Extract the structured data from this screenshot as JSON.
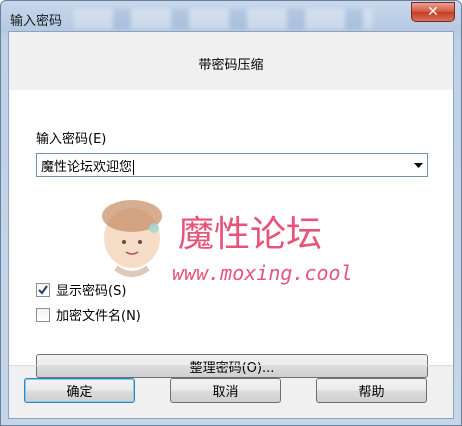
{
  "window": {
    "title": "输入密码",
    "close_glyph": "✕"
  },
  "header": {
    "title": "带密码压缩"
  },
  "password": {
    "label": "输入密码(E)",
    "value": "魔性论坛欢迎您"
  },
  "options": {
    "show_password_label": "显示密码(S)",
    "show_password_checked": true,
    "encrypt_filenames_label": "加密文件名(N)",
    "encrypt_filenames_checked": false
  },
  "organize_button": "整理密码(O)...",
  "buttons": {
    "ok": "确定",
    "cancel": "取消",
    "help": "帮助"
  },
  "watermark": {
    "title": "魔性论坛",
    "url": "www.moxing.cool",
    "color": "#e6466e"
  }
}
